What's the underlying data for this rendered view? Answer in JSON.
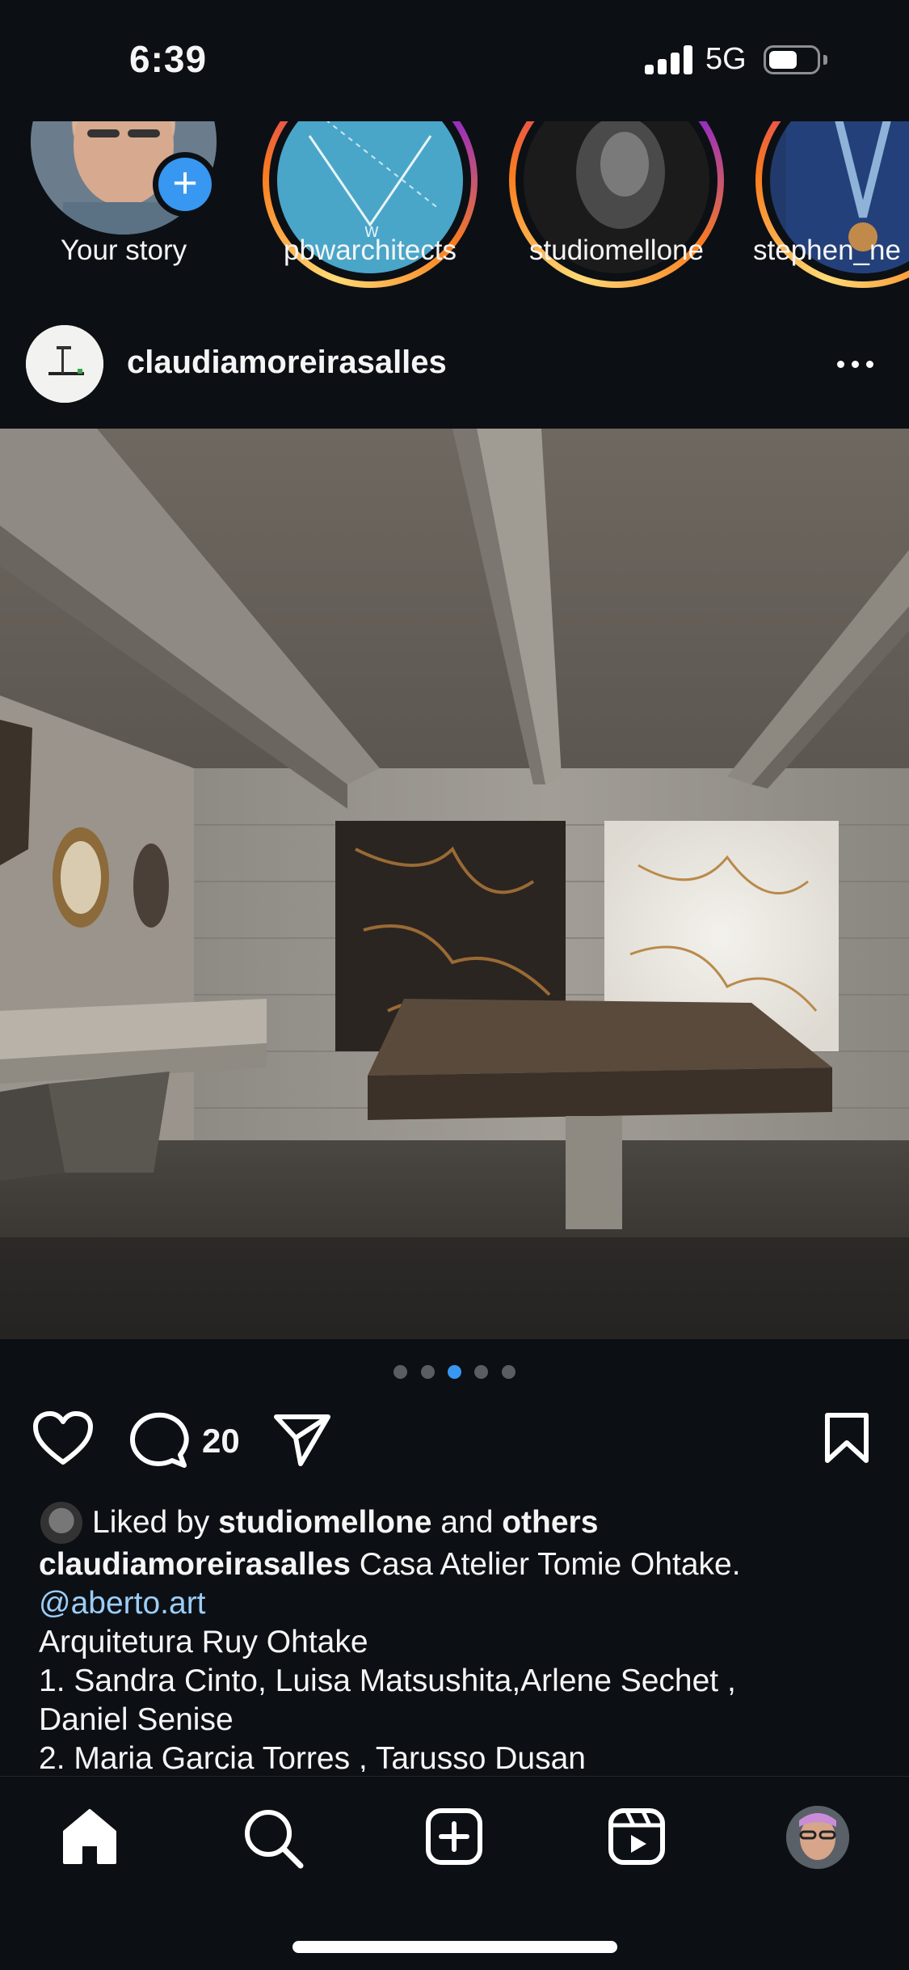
{
  "status_bar": {
    "time": "6:39",
    "network": "5G",
    "battery_level": 0.55
  },
  "stories": [
    {
      "username": "Your story",
      "icon": "add-story-icon"
    },
    {
      "username": "pbwarchitects"
    },
    {
      "username": "studiomellone"
    },
    {
      "username": "stephen_ne"
    }
  ],
  "post": {
    "username": "claudiamoreirasalles",
    "more_icon": "more-horizontal-icon",
    "image": {
      "carousel_total": 5,
      "carousel_active_index": 2
    },
    "comment_count": "20",
    "liked_by": {
      "prefix": "Liked by",
      "user": "studiomellone",
      "conjunction": "and",
      "others": "others"
    },
    "caption": {
      "username": "claudiamoreirasalles",
      "text": "Casa Atelier Tomie Ohtake.",
      "mention": "@aberto.art",
      "line2": "Arquitetura  Ruy Ohtake",
      "line3": "1. Sandra Cinto, Luisa Matsushita,Arlene Sechet ,",
      "line4": "Daniel Senise",
      "line5": "2. Maria Garcia Torres , Tarusso Dusan"
    }
  },
  "tab_bar": {
    "items": [
      {
        "name": "home",
        "icon": "home-icon",
        "active": true
      },
      {
        "name": "search",
        "icon": "search-icon"
      },
      {
        "name": "create",
        "icon": "plus-square-icon"
      },
      {
        "name": "reels",
        "icon": "reels-icon"
      },
      {
        "name": "profile",
        "icon": "profile-avatar"
      }
    ]
  },
  "colors": {
    "background": "#0c1014",
    "accent_blue": "#3897f0",
    "mention": "#9ccdf8",
    "story_ring": [
      "#feda75",
      "#fa7e1e",
      "#d62976"
    ]
  }
}
